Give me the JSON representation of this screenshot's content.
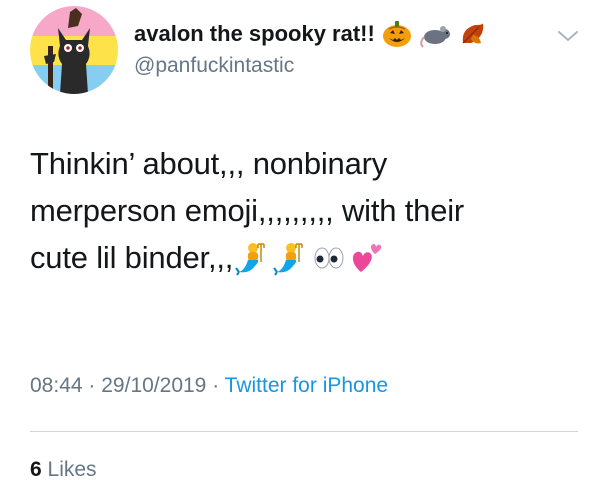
{
  "user": {
    "display_name": "avalon the spooky rat!!",
    "handle": "@panfuckintastic",
    "name_emojis": [
      "jack-o-lantern",
      "rat",
      "fallen-leaf"
    ]
  },
  "tweet": {
    "lines": [
      "Thinkin’ about,,, nonbinary",
      "merperson emoji,,,,,,,,, with their",
      "cute lil binder,,,"
    ],
    "trailing_emojis": [
      "merperson",
      "merperson",
      "eyes",
      "two-hearts"
    ]
  },
  "meta": {
    "time": "08:44",
    "separator": "·",
    "date": "29/10/2019",
    "source": "Twitter for iPhone"
  },
  "engagement": {
    "likes_count": "6",
    "likes_label": "Likes"
  },
  "colors": {
    "text": "#14171a",
    "secondary": "#657786",
    "link": "#1b95e0",
    "divider": "#ccd6dd",
    "flag_pink": "#f9a3c7",
    "flag_yellow": "#fde047",
    "flag_blue": "#7cc7f1"
  }
}
